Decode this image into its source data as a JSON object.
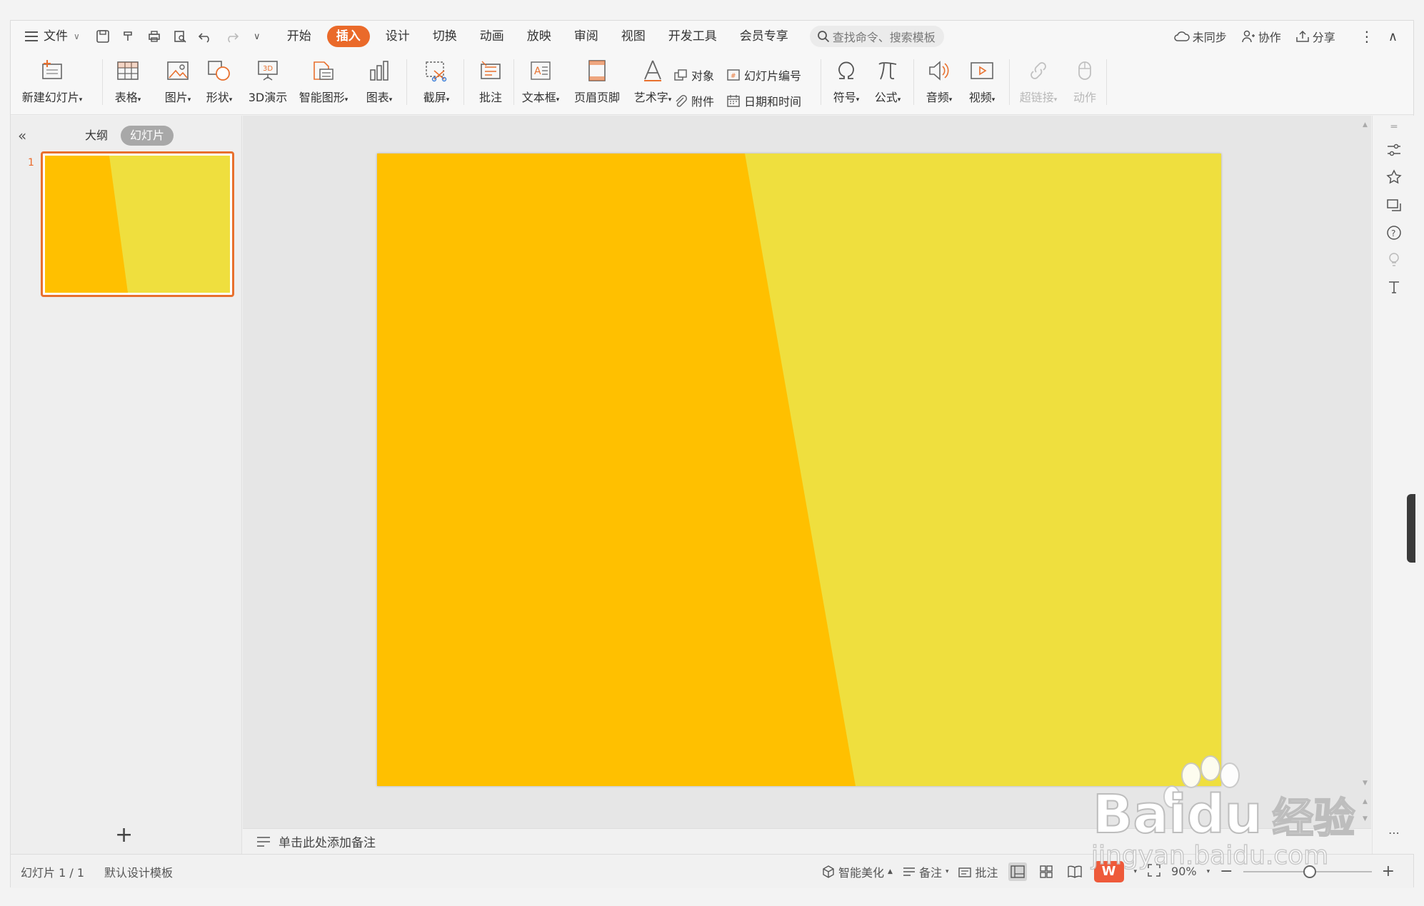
{
  "menubar": {
    "file_label": "文件",
    "tabs": [
      "开始",
      "插入",
      "设计",
      "切换",
      "动画",
      "放映",
      "审阅",
      "视图",
      "开发工具",
      "会员专享"
    ],
    "active_tab": "插入",
    "search_placeholder": "查找命令、搜索模板",
    "right_actions": {
      "sync": "未同步",
      "collab": "协作",
      "share": "分享"
    }
  },
  "ribbon": {
    "new_slide": "新建幻灯片",
    "table": "表格",
    "picture": "图片",
    "shape": "形状",
    "demo3d": "3D演示",
    "smartart": "智能图形",
    "chart": "图表",
    "screenshot": "截屏",
    "comment": "批注",
    "textbox": "文本框",
    "header_footer": "页眉页脚",
    "wordart": "艺术字",
    "object": "对象",
    "attachment": "附件",
    "slide_number": "幻灯片编号",
    "datetime": "日期和时间",
    "symbol": "符号",
    "formula": "公式",
    "audio": "音频",
    "video": "视频",
    "hyperlink": "超链接",
    "action": "动作"
  },
  "leftpanel": {
    "tab_outline": "大纲",
    "tab_slides": "幻灯片",
    "slide_number": "1",
    "add_icon": "+"
  },
  "slide": {
    "left_color": "#ffc000",
    "right_color": "#efdf3e",
    "accent_color": "#e8702e"
  },
  "notes": {
    "placeholder": "单击此处添加备注"
  },
  "statusbar": {
    "slide_count": "幻灯片 1 / 1",
    "template": "默认设计模板",
    "beautify": "智能美化",
    "notes": "备注",
    "comments": "批注",
    "zoom": "90%",
    "wps_logo_text": "W"
  },
  "watermark": {
    "brand": "Bai",
    "brand2": "du",
    "brand_cn": "经验",
    "url": "jingyan.baidu.com"
  }
}
